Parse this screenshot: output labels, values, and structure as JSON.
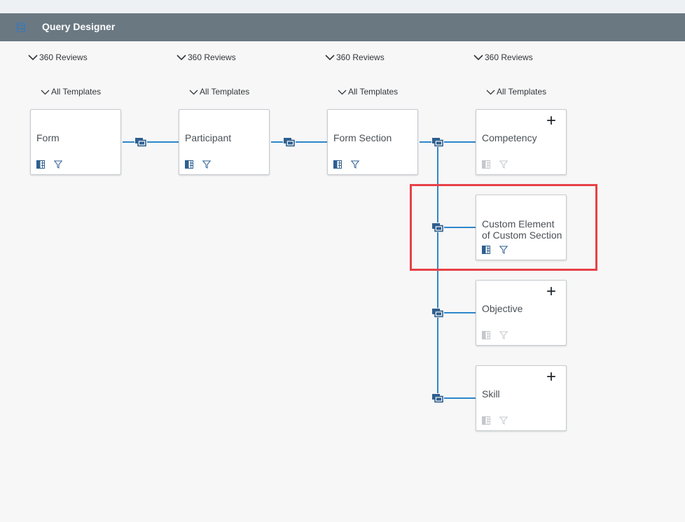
{
  "header": {
    "title": "Query Designer",
    "icon": "database-icon"
  },
  "columns": [
    {
      "context": "360 Reviews",
      "template": "All Templates"
    },
    {
      "context": "360 Reviews",
      "template": "All Templates"
    },
    {
      "context": "360 Reviews",
      "template": "All Templates"
    },
    {
      "context": "360 Reviews",
      "template": "All Templates"
    }
  ],
  "nodes": {
    "form": {
      "label": "Form",
      "has_plus": false,
      "icons_active": true
    },
    "participant": {
      "label": "Participant",
      "has_plus": false,
      "icons_active": true
    },
    "form_section": {
      "label": "Form Section",
      "has_plus": false,
      "icons_active": true
    },
    "competency": {
      "label": "Competency",
      "has_plus": true,
      "icons_active": false
    },
    "custom_element": {
      "label": "Custom Element of Custom Section",
      "has_plus": false,
      "icons_active": true
    },
    "objective": {
      "label": "Objective",
      "has_plus": true,
      "icons_active": false
    },
    "skill": {
      "label": "Skill",
      "has_plus": true,
      "icons_active": false
    }
  },
  "plus_symbol": "+",
  "colors": {
    "header_bg": "#6a7882",
    "wire": "#2f86c9",
    "icon_active": "#2e5f8f",
    "icon_inactive": "#c4c8cc",
    "highlight": "#e84148"
  }
}
